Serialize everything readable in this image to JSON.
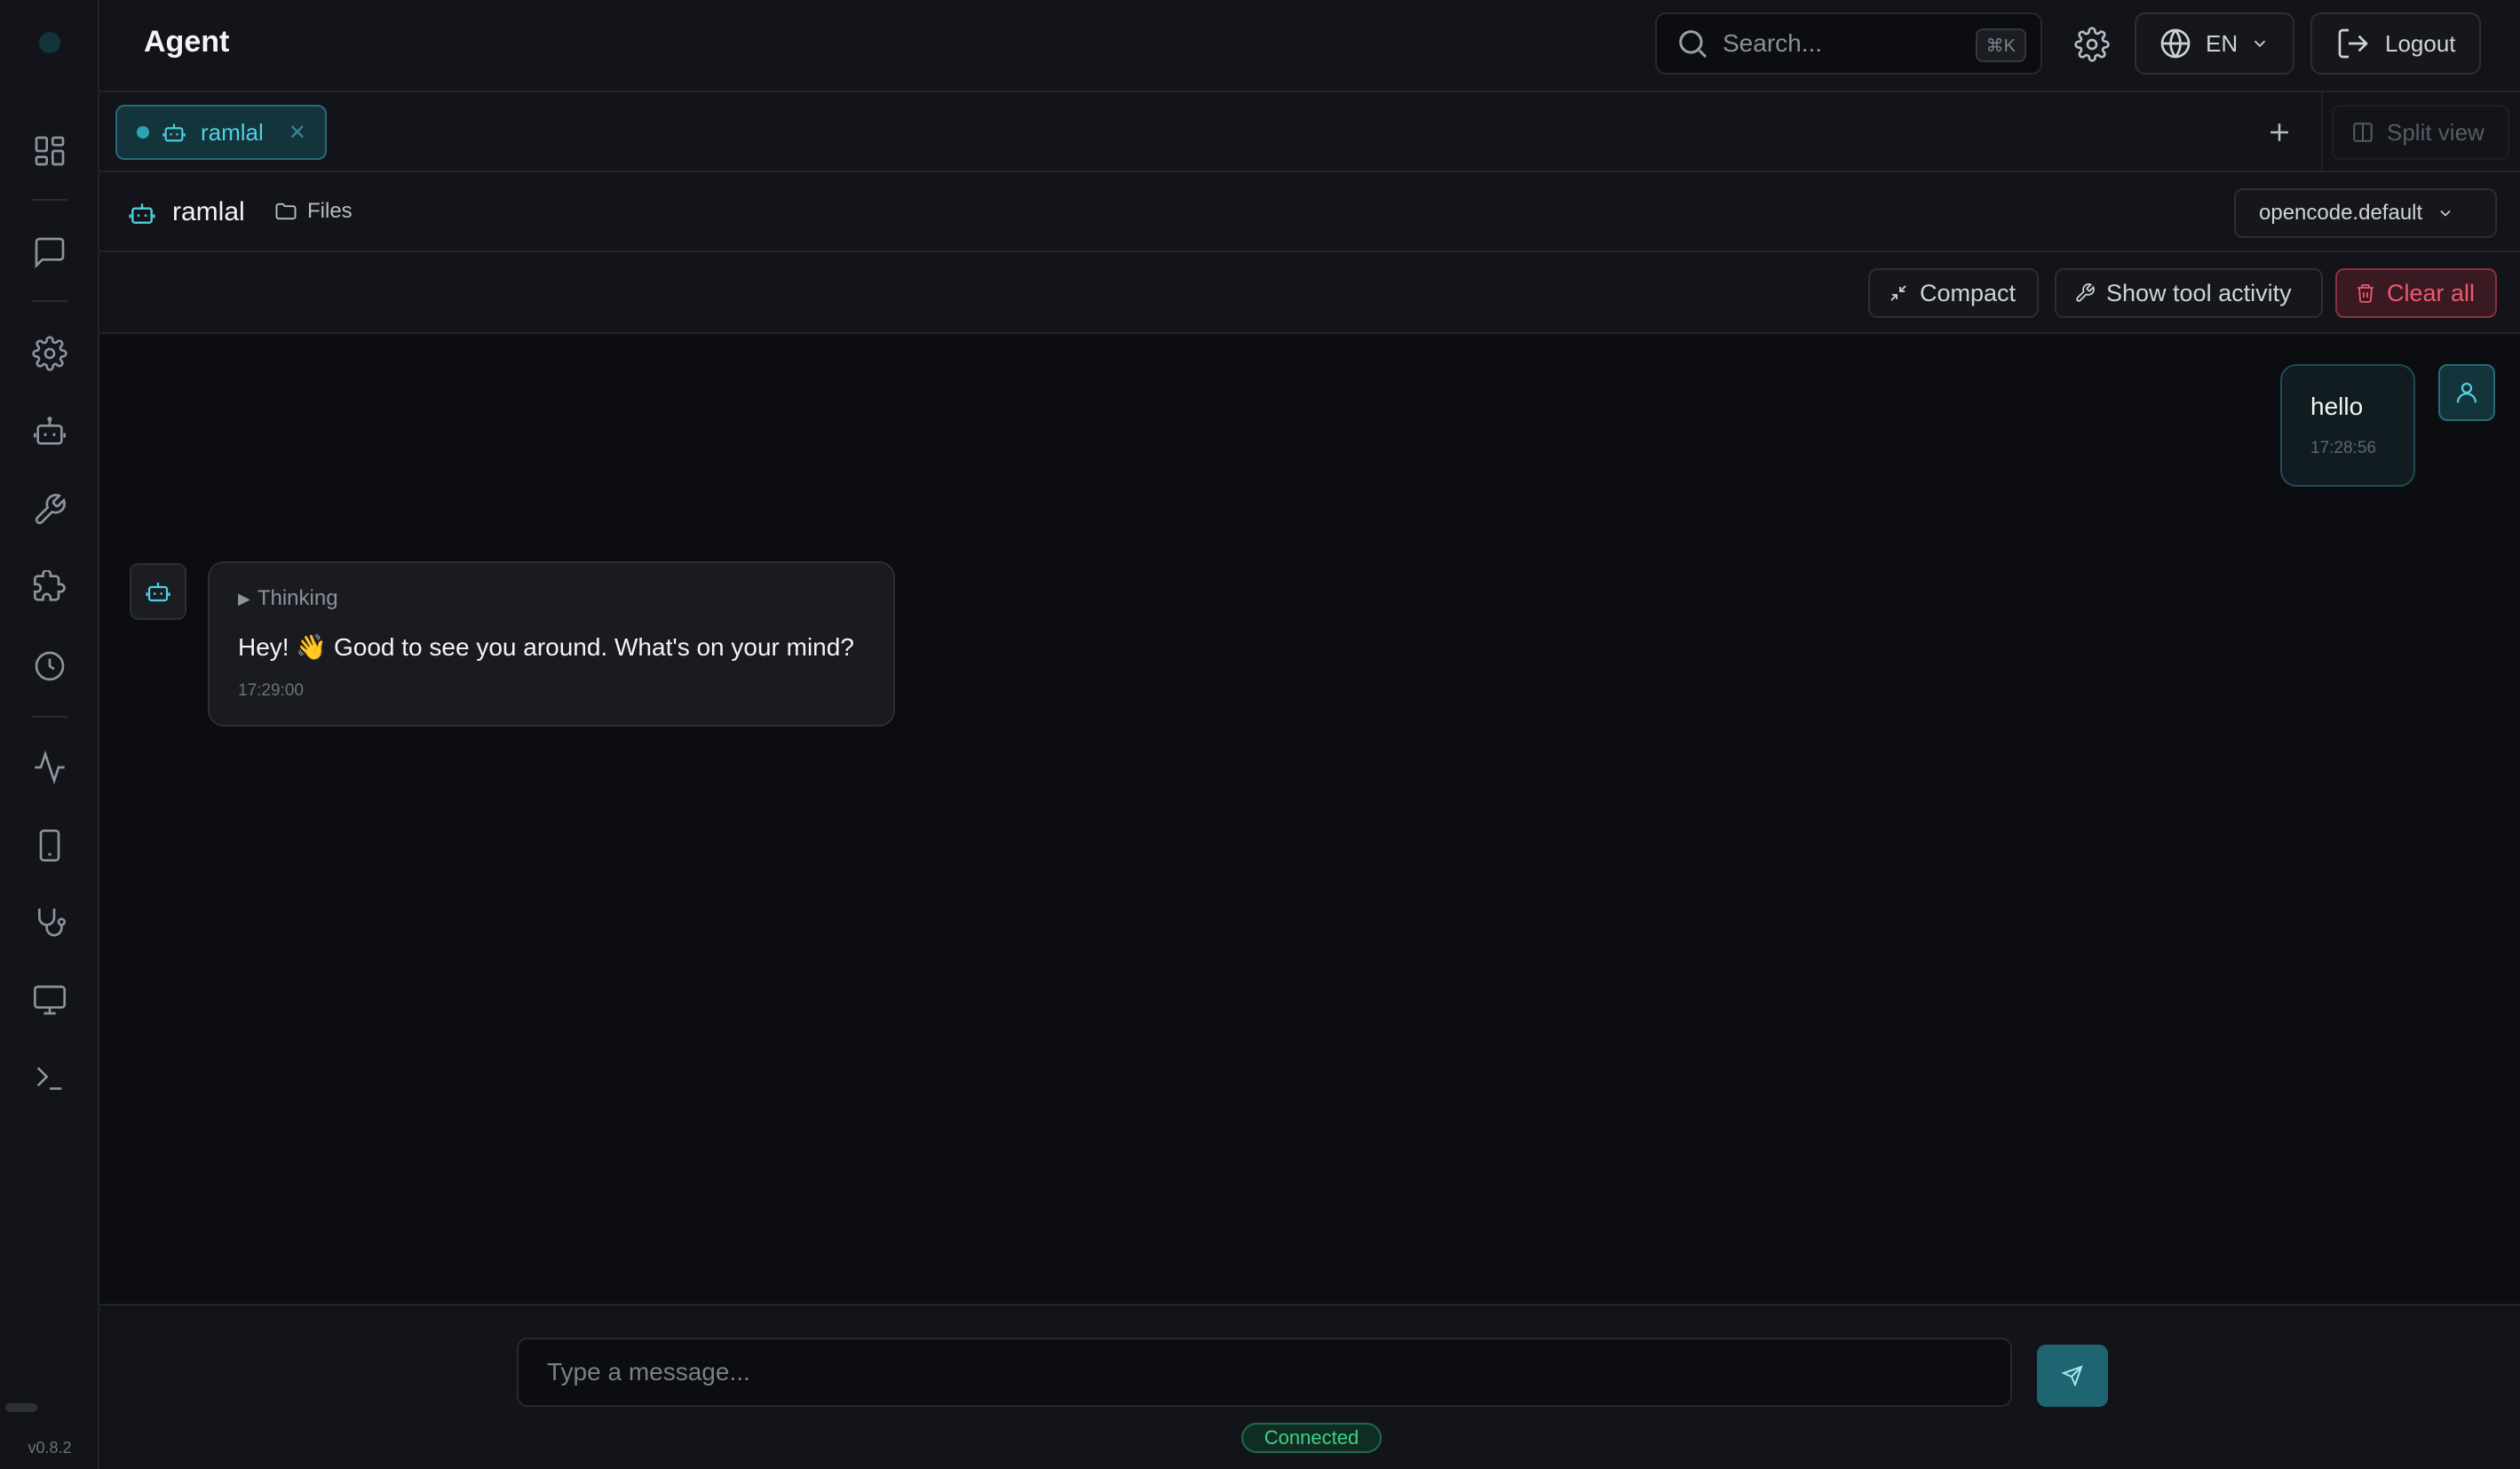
{
  "app": {
    "title": "Agent",
    "version": "v0.8.2"
  },
  "header": {
    "search_placeholder": "Search...",
    "search_shortcut": "⌘K",
    "language": "EN",
    "logout_label": "Logout"
  },
  "sidebar": {
    "items": [
      {
        "icon": "dashboard-icon"
      },
      {
        "icon": "chat-icon"
      },
      {
        "icon": "gear-icon"
      },
      {
        "icon": "bot-icon"
      },
      {
        "icon": "wrench-icon"
      },
      {
        "icon": "puzzle-icon"
      },
      {
        "icon": "clock-icon"
      },
      {
        "icon": "activity-icon"
      },
      {
        "icon": "mobile-icon"
      },
      {
        "icon": "stethoscope-icon"
      },
      {
        "icon": "monitor-icon"
      },
      {
        "icon": "terminal-icon"
      }
    ]
  },
  "tabs": {
    "items": [
      {
        "label": "ramlal",
        "active": true
      }
    ],
    "split_view_label": "Split view"
  },
  "agent_bar": {
    "name": "ramlal",
    "files_label": "Files",
    "model": "opencode.default"
  },
  "actions": {
    "compact_label": "Compact",
    "tool_activity_label": "Show tool activity",
    "clear_label": "Clear all"
  },
  "messages": [
    {
      "role": "user",
      "text": "hello",
      "time": "17:28:56"
    },
    {
      "role": "assistant",
      "thinking_label": "Thinking",
      "text": "Hey! 👋 Good to see you around. What's on your mind?",
      "time": "17:29:00"
    }
  ],
  "composer": {
    "placeholder": "Type a message...",
    "status": "Connected"
  },
  "colors": {
    "accent": "#4fd1e3",
    "danger": "#f0586e",
    "success": "#3fd08a",
    "background": "#0c0d10",
    "panel": "#131419"
  }
}
